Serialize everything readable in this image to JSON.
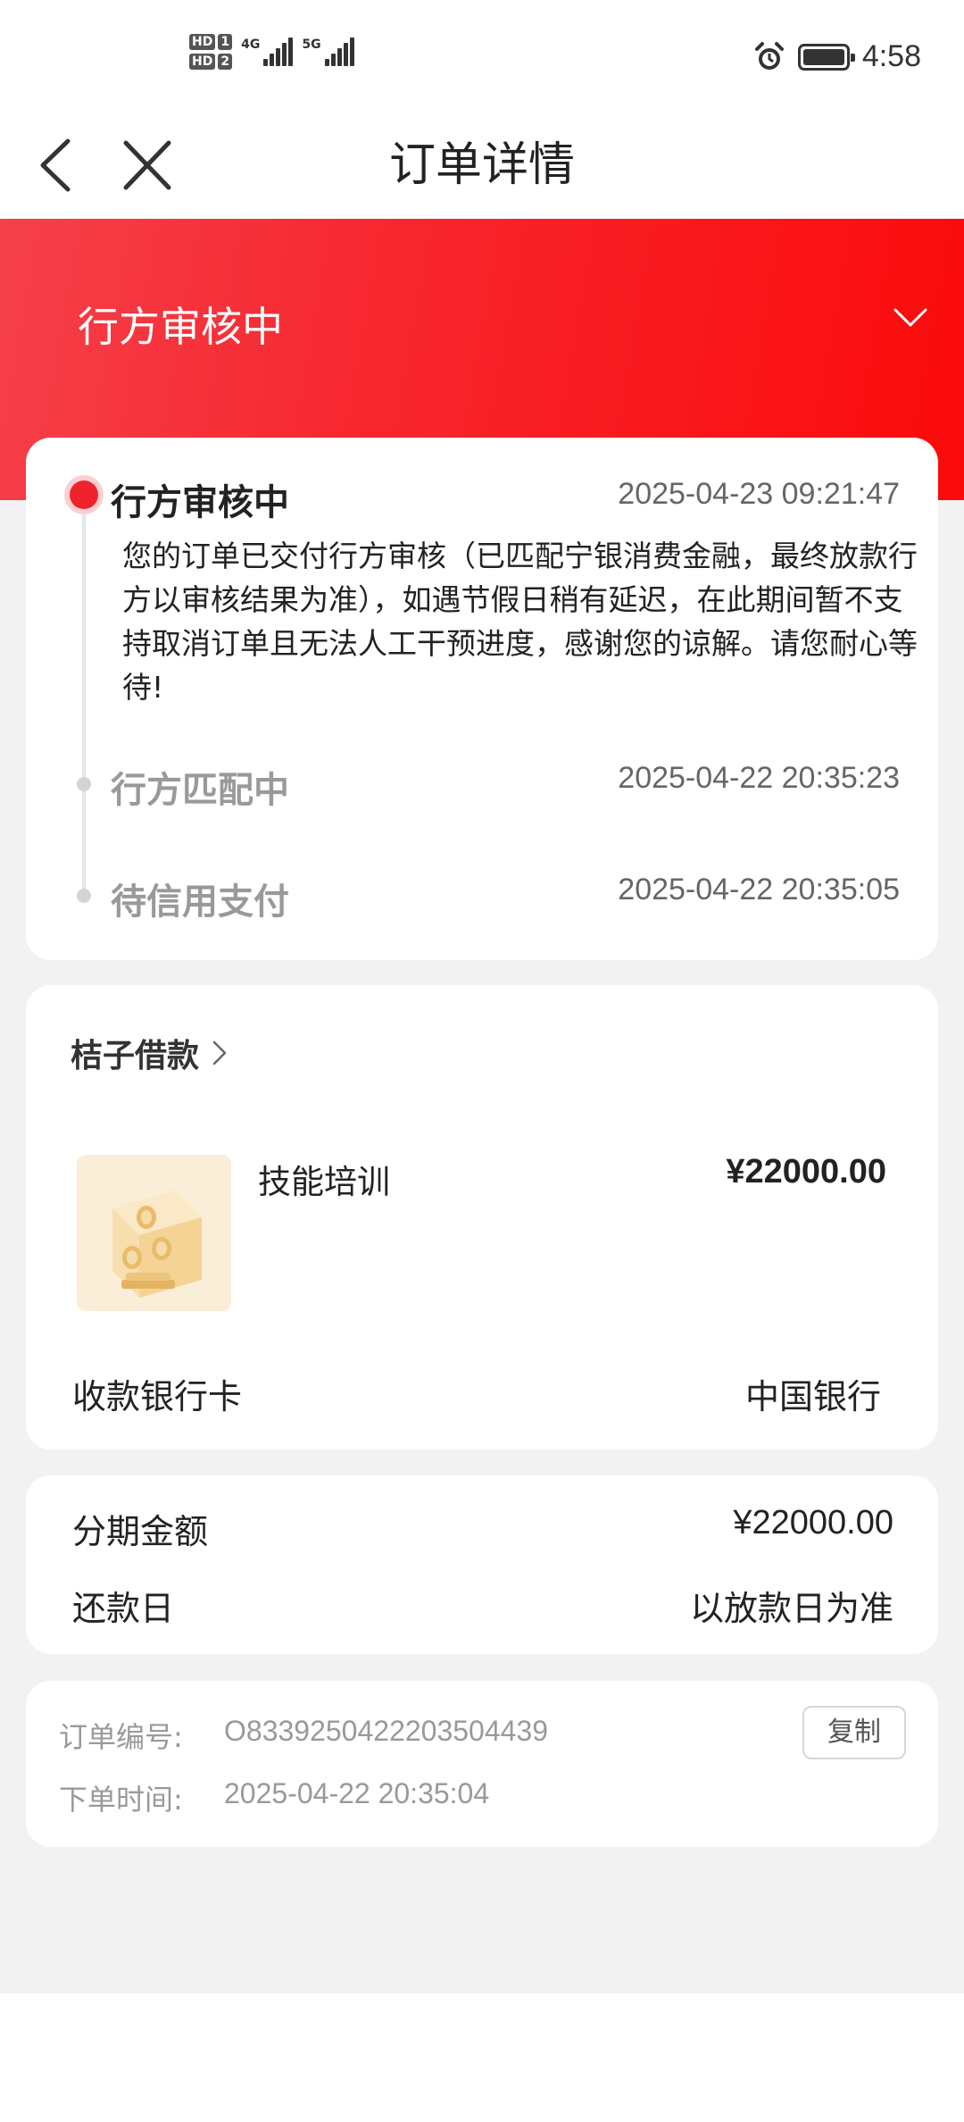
{
  "status_bar": {
    "sim1_label": "HD",
    "sim1_num": "1",
    "sim2_label": "HD",
    "sim2_num": "2",
    "net1": "4G",
    "net2": "5G",
    "time": "4:58",
    "icons": [
      "alarm-icon",
      "battery-icon"
    ]
  },
  "nav": {
    "title": "订单详情",
    "back_icon": "chevron-left-icon",
    "close_icon": "close-icon"
  },
  "banner": {
    "status": "行方审核中",
    "toggle_icon": "chevron-down-icon",
    "accent_color": "#f7262e"
  },
  "timeline": [
    {
      "title": "行方审核中",
      "time": "2025-04-23 09:21:47",
      "desc": "您的订单已交付行方审核（已匹配宁银消费金融，最终放款行方以审核结果为准），如遇节假日稍有延迟，在此期间暂不支持取消订单且无法人工干预进度，感谢您的谅解。请您耐心等待!"
    },
    {
      "title": "行方匹配中",
      "time": "2025-04-22 20:35:23"
    },
    {
      "title": "待信用支付",
      "time": "2025-04-22 20:35:05"
    }
  ],
  "product": {
    "shop": "桔子借款",
    "name": "技能培训",
    "price": "¥22000.00",
    "bank_label": "收款银行卡",
    "bank_value": "中国银行"
  },
  "amount": {
    "installment_label": "分期金额",
    "installment_value": "¥22000.00",
    "repay_label": "还款日",
    "repay_value": "以放款日为准"
  },
  "order": {
    "number_label": "订单编号:",
    "number_value": "O833925042220350443​9",
    "time_label": "下单时间:",
    "time_value": "2025-04-22 20:35:04",
    "copy_label": "复制"
  }
}
